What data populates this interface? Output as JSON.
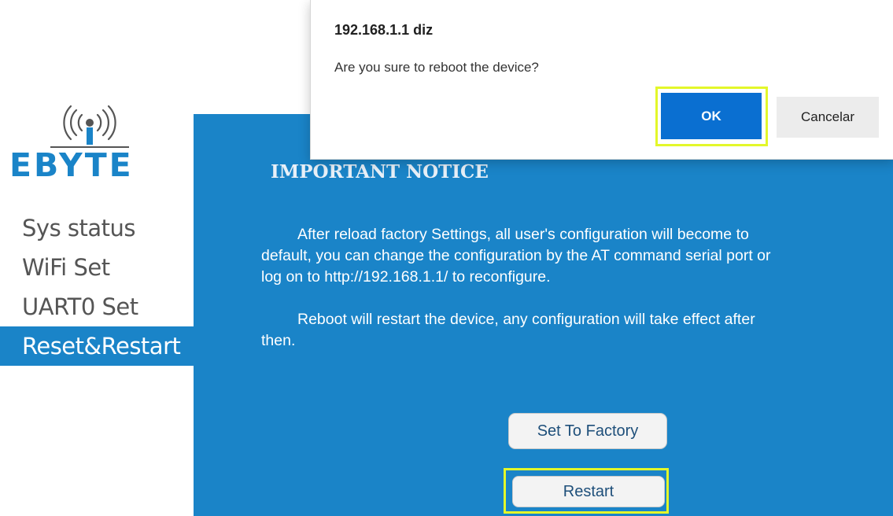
{
  "logo": {
    "text": "EBYTE",
    "icon": "wifi-tower-icon",
    "color": "#1a84c8"
  },
  "sidebar": {
    "items": [
      {
        "label": "Sys status",
        "active": false
      },
      {
        "label": "WiFi Set",
        "active": false
      },
      {
        "label": "UART0 Set",
        "active": false
      },
      {
        "label": "Reset&Restart",
        "active": true
      }
    ]
  },
  "main": {
    "background": "#1a84c8",
    "notice_title": "IMPORTANT NOTICE",
    "para1_line1": "After reload factory Settings, all user's configuration will become to",
    "para1_line2": "default, you can change the configuration by the AT command serial port or",
    "para1_line3": "log on to http://192.168.1.1/ to reconfigure.",
    "para2_line1": "Reboot will restart the device, any configuration will take effect after",
    "para2_line2": "then.",
    "factory_label": "Set To Factory",
    "restart_label": "Restart"
  },
  "dialog": {
    "title": "192.168.1.1 diz",
    "message": "Are you sure to reboot the device?",
    "ok_label": "OK",
    "cancel_label": "Cancelar",
    "ok_color": "#0a6fd1",
    "highlight_color": "#e3f72a"
  }
}
